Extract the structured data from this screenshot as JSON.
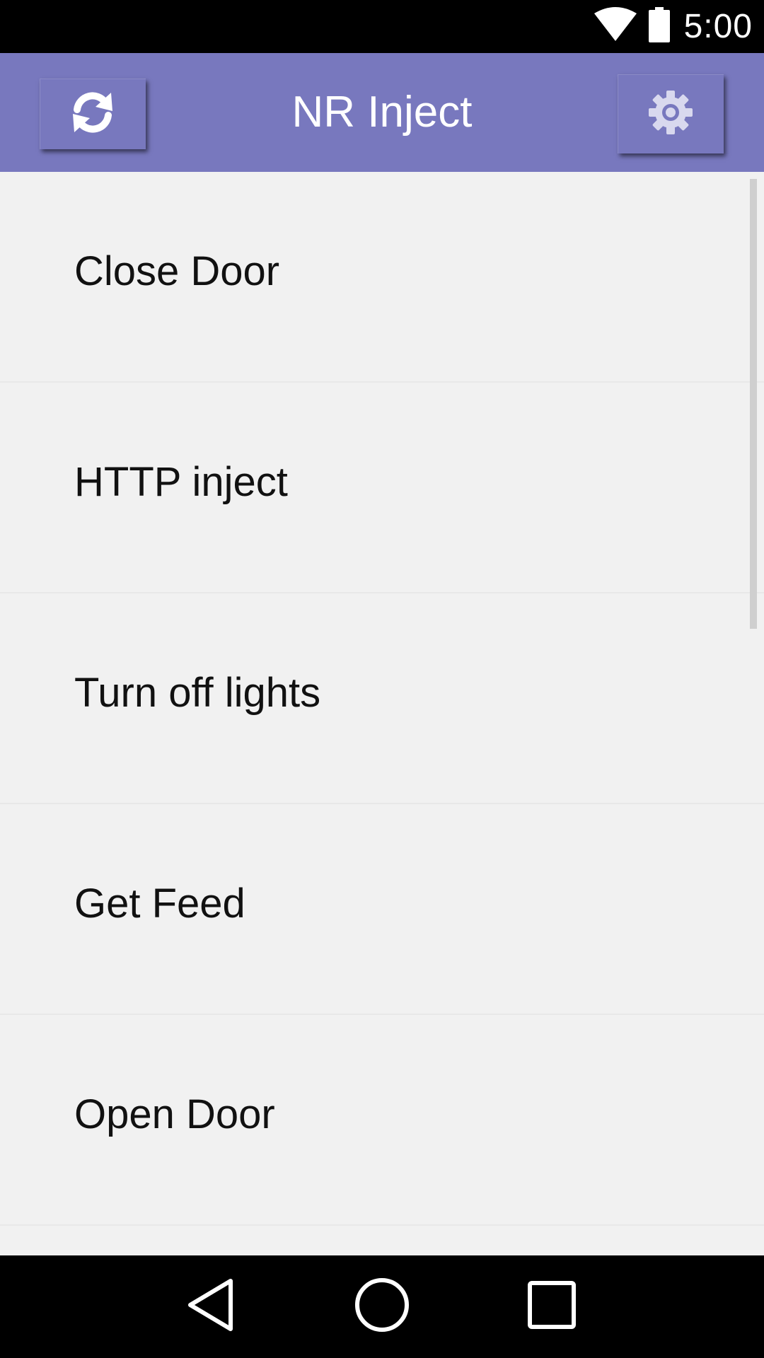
{
  "status_bar": {
    "time": "5:00",
    "icons": [
      "wifi-icon",
      "battery-icon"
    ]
  },
  "app_bar": {
    "title": "NR Inject",
    "refresh_icon": "refresh-icon",
    "settings_icon": "gear-icon",
    "color": "#7878be"
  },
  "list": {
    "items": [
      {
        "label": "Close Door"
      },
      {
        "label": "HTTP inject"
      },
      {
        "label": "Turn off lights"
      },
      {
        "label": "Get Feed"
      },
      {
        "label": "Open Door"
      }
    ]
  },
  "nav_bar": {
    "icons": [
      "back-icon",
      "home-icon",
      "recents-icon"
    ]
  }
}
